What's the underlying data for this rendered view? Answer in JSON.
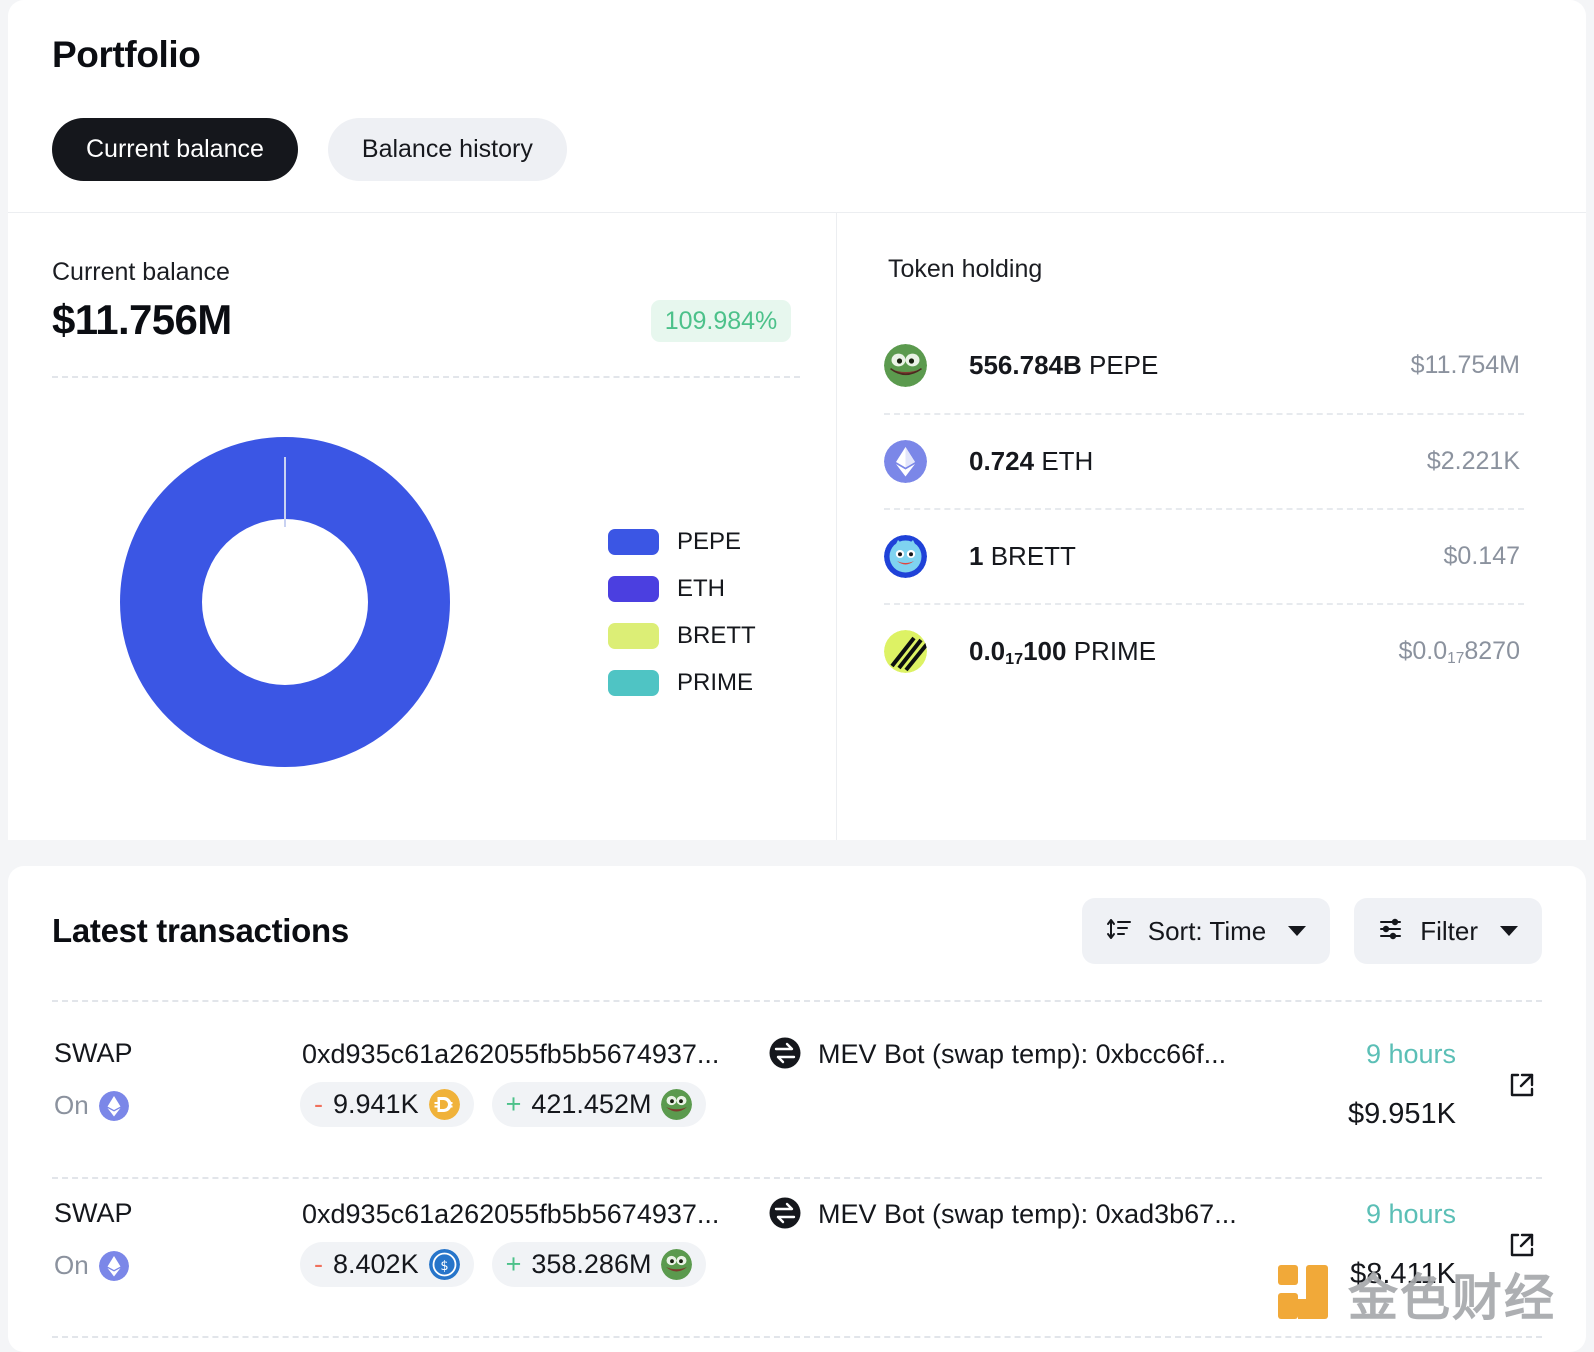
{
  "header": {
    "title": "Portfolio",
    "tabs": [
      {
        "label": "Current balance",
        "active": true
      },
      {
        "label": "Balance history",
        "active": false
      }
    ]
  },
  "balance": {
    "label": "Current balance",
    "value": "$11.756M",
    "change_pct": "109.984%",
    "change_color": "#4cc18a"
  },
  "chart_data": {
    "type": "pie",
    "title": "",
    "legend_position": "right",
    "categories": [
      "PEPE",
      "ETH",
      "BRETT",
      "PRIME"
    ],
    "values": [
      11.754,
      0.002221,
      1.47e-07,
      8.27e-19
    ],
    "percentages": [
      99.98,
      0.02,
      1.3e-06,
      0.0
    ],
    "colors": [
      "#3b56e4",
      "#4b3fe0",
      "#dcee76",
      "#4fc4c4"
    ],
    "units": "USD millions",
    "donut": true,
    "legend": [
      {
        "label": "PEPE",
        "color": "#3b56e4"
      },
      {
        "label": "ETH",
        "color": "#4b3fe0"
      },
      {
        "label": "BRETT",
        "color": "#dcee76"
      },
      {
        "label": "PRIME",
        "color": "#4fc4c4"
      }
    ]
  },
  "token_holding": {
    "title": "Token holding",
    "rows": [
      {
        "icon": "pepe-token-icon",
        "amount": "556.784B",
        "symbol": "PEPE",
        "usd": "$11.754M"
      },
      {
        "icon": "eth-token-icon",
        "amount": "0.724",
        "symbol": "ETH",
        "usd": "$2.221K"
      },
      {
        "icon": "brett-token-icon",
        "amount": "1",
        "symbol": "BRETT",
        "usd": "$0.147"
      },
      {
        "icon": "prime-token-icon",
        "amount_pre": "0.0",
        "amount_sub": "17",
        "amount_post": "100",
        "symbol": "PRIME",
        "usd_pre": "$0.0",
        "usd_sub": "17",
        "usd_post": "8270"
      }
    ]
  },
  "transactions": {
    "title": "Latest transactions",
    "controls": {
      "sort": {
        "label": "Sort: Time",
        "icon": "sort-icon"
      },
      "filter": {
        "label": "Filter",
        "icon": "filter-icon"
      }
    },
    "rows": [
      {
        "type": "SWAP",
        "on_label": "On",
        "chain_icon": "ethereum-icon",
        "hash": "0xd935c61a262055fb5b5674937...",
        "direction_icon": "swap-arrows-icon",
        "counterparty": "MEV Bot (swap temp): 0xbcc66f...",
        "out": {
          "sign": "-",
          "amount": "9.941K",
          "icon": "dai-token-icon"
        },
        "in": {
          "sign": "+",
          "amount": "421.452M",
          "icon": "pepe-token-icon"
        },
        "time": "9 hours",
        "value": "$9.951K",
        "external_icon": "external-link-icon"
      },
      {
        "type": "SWAP",
        "on_label": "On",
        "chain_icon": "ethereum-icon",
        "hash": "0xd935c61a262055fb5b5674937...",
        "direction_icon": "swap-arrows-icon",
        "counterparty": "MEV Bot (swap temp): 0xad3b67...",
        "out": {
          "sign": "-",
          "amount": "8.402K",
          "icon": "usdc-token-icon"
        },
        "in": {
          "sign": "+",
          "amount": "358.286M",
          "icon": "pepe-token-icon"
        },
        "time": "9 hours",
        "value": "$8.411K",
        "external_icon": "external-link-icon"
      }
    ]
  },
  "watermark": {
    "text": "金色财经",
    "color": "#f0a229"
  }
}
